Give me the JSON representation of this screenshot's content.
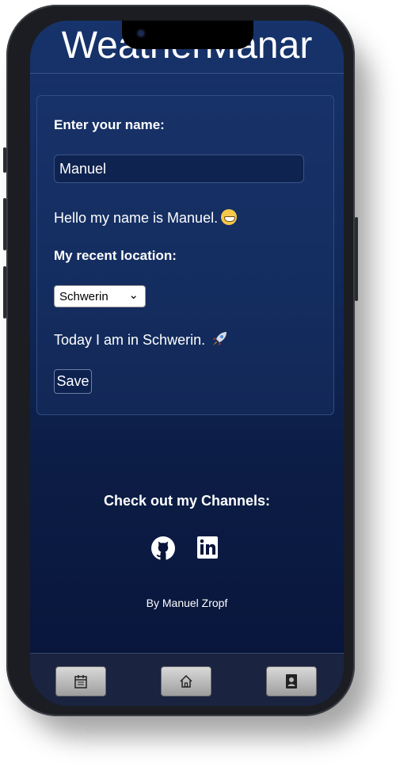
{
  "app": {
    "title": "WeatherManar"
  },
  "form": {
    "name_label": "Enter your name:",
    "name_value": "Manuel",
    "greeting": "Hello my name is Manuel.",
    "location_label": "My recent location:",
    "location_selected": "Schwerin",
    "location_text": "Today I am in Schwerin.",
    "save_label": "Save"
  },
  "footer": {
    "channels_title": "Check out my Channels:",
    "byline": "By Manuel Zropf"
  },
  "icons": {
    "greeting_emoji": "grinning-face-icon",
    "location_emoji": "rocket-icon",
    "social": [
      "github-icon",
      "linkedin-icon"
    ],
    "nav": [
      "calendar-icon",
      "home-icon",
      "contact-icon"
    ]
  },
  "colors": {
    "screen_top": "#17336b",
    "screen_bottom": "#08143a"
  }
}
